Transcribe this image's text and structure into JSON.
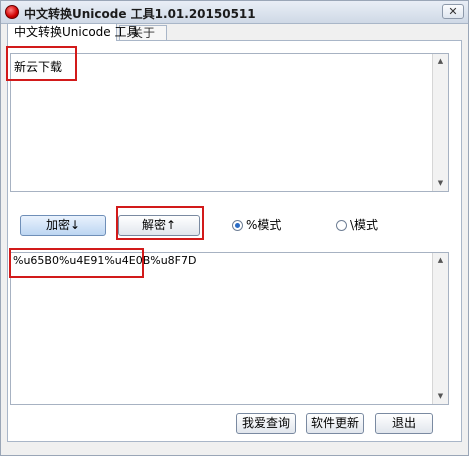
{
  "window": {
    "title": "中文转换Unicode 工具1.01.20150511",
    "close_symbol": "✕"
  },
  "tabs": [
    {
      "label": "中文转换Unicode 工具"
    },
    {
      "label": "关于"
    }
  ],
  "input": {
    "value": "新云下载"
  },
  "actions": {
    "encrypt_label": "加密↓",
    "decrypt_label": "解密↑"
  },
  "modes": [
    {
      "label": "%模式",
      "checked": true
    },
    {
      "label": "\\模式",
      "checked": false
    }
  ],
  "output": {
    "value": "%u65B0%u4E91%u4E0B%u8F7D"
  },
  "footer": {
    "about_label": "我爱查询",
    "update_label": "软件更新",
    "exit_label": "退出"
  },
  "colors": {
    "highlight": "#d21a1a",
    "accent": "#2a6bc4"
  }
}
